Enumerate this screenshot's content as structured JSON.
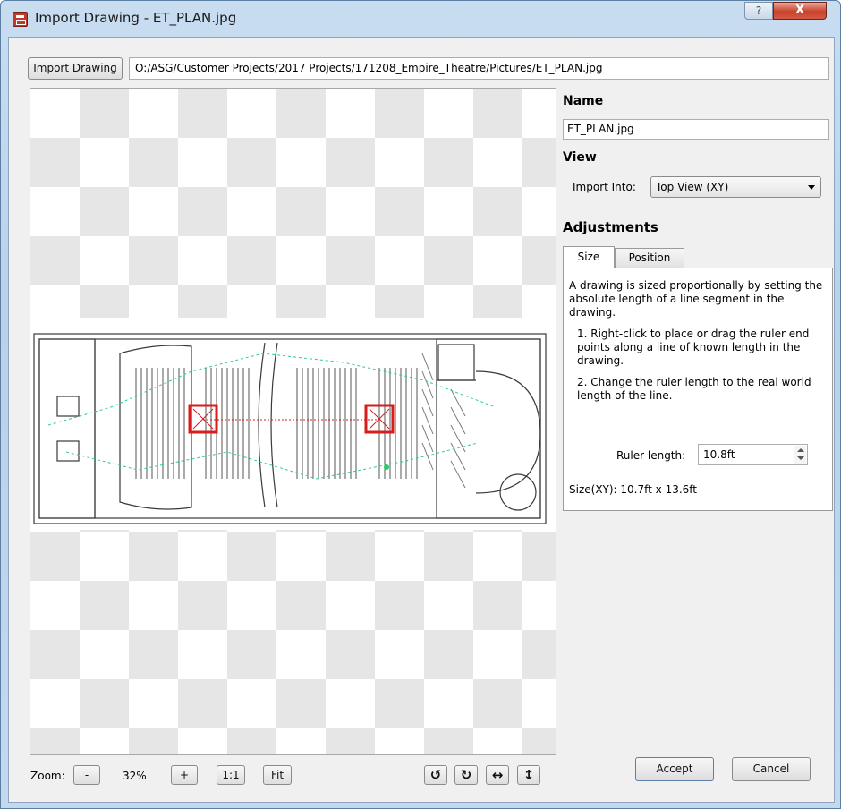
{
  "window": {
    "title": "Import Drawing - ET_PLAN.jpg",
    "help_glyph": "?",
    "close_glyph": "X"
  },
  "toolbar": {
    "import_label": "Import Drawing",
    "path": "O:/ASG/Customer Projects/2017 Projects/171208_Empire_Theatre/Pictures/ET_PLAN.jpg"
  },
  "zoom": {
    "label": "Zoom:",
    "minus": "-",
    "value": "32%",
    "plus": "+",
    "one_to_one": "1:1",
    "fit": "Fit"
  },
  "transform_buttons": {
    "rotate_ccw": "↺",
    "rotate_cw": "↻",
    "flip_horizontal": "↔",
    "flip_vertical": "↕"
  },
  "panel": {
    "name_heading": "Name",
    "name_value": "ET_PLAN.jpg",
    "view_heading": "View",
    "import_into_label": "Import Into:",
    "import_into_value": "Top View (XY)",
    "adjustments_heading": "Adjustments",
    "tabs": [
      {
        "label": "Size",
        "active": true
      },
      {
        "label": "Position",
        "active": false
      }
    ],
    "intro": "A drawing is sized proportionally by setting the absolute length of a line segment in the drawing.",
    "step1": "1. Right-click to place or drag the ruler end points along a line of known length in the drawing.",
    "step2": "2. Change the ruler length to the real world length of the line.",
    "ruler_label": "Ruler length:",
    "ruler_value": "10.8ft",
    "size_xy": "Size(XY): 10.7ft x 13.6ft"
  },
  "footer": {
    "accept": "Accept",
    "cancel": "Cancel"
  },
  "colors": {
    "ruler_marker": "#d81c1c",
    "annotation": "#2ec9a0",
    "floorplan_lines": "#333333"
  }
}
